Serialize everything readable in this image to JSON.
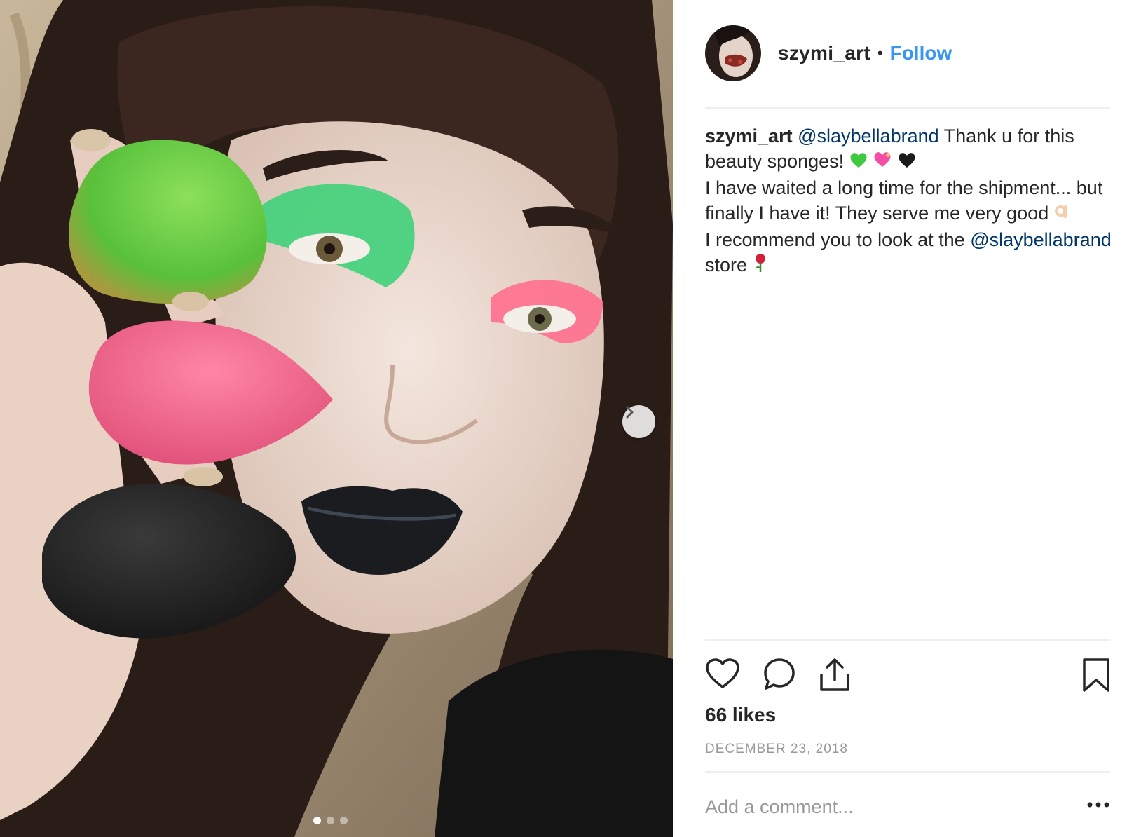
{
  "post": {
    "username": "szymi_art",
    "separator": "•",
    "follow_label": "Follow",
    "caption": {
      "user": "szymi_art",
      "mention_1": "@slaybellabrand",
      "text_1": " Thank u for this beauty sponges! ",
      "line_2": "I have waited a long time for the shipment... but finally I have it! They serve me very good ",
      "line_3": "I recommend you to look at the ",
      "mention_2": "@slaybellabrand",
      "text_3": " store "
    },
    "likes": "66 likes",
    "date": "DECEMBER 23, 2018",
    "comment_placeholder": "Add a comment...",
    "carousel": {
      "total_slides": 3,
      "active_slide": 1
    }
  },
  "icons": [
    "heart-icon",
    "comment-icon",
    "share-icon",
    "bookmark-icon",
    "more-options-icon",
    "chevron-right-icon"
  ],
  "colors": {
    "link_blue": "#3897f0",
    "mention_blue": "#003569",
    "text": "#262626",
    "muted": "#999999"
  }
}
